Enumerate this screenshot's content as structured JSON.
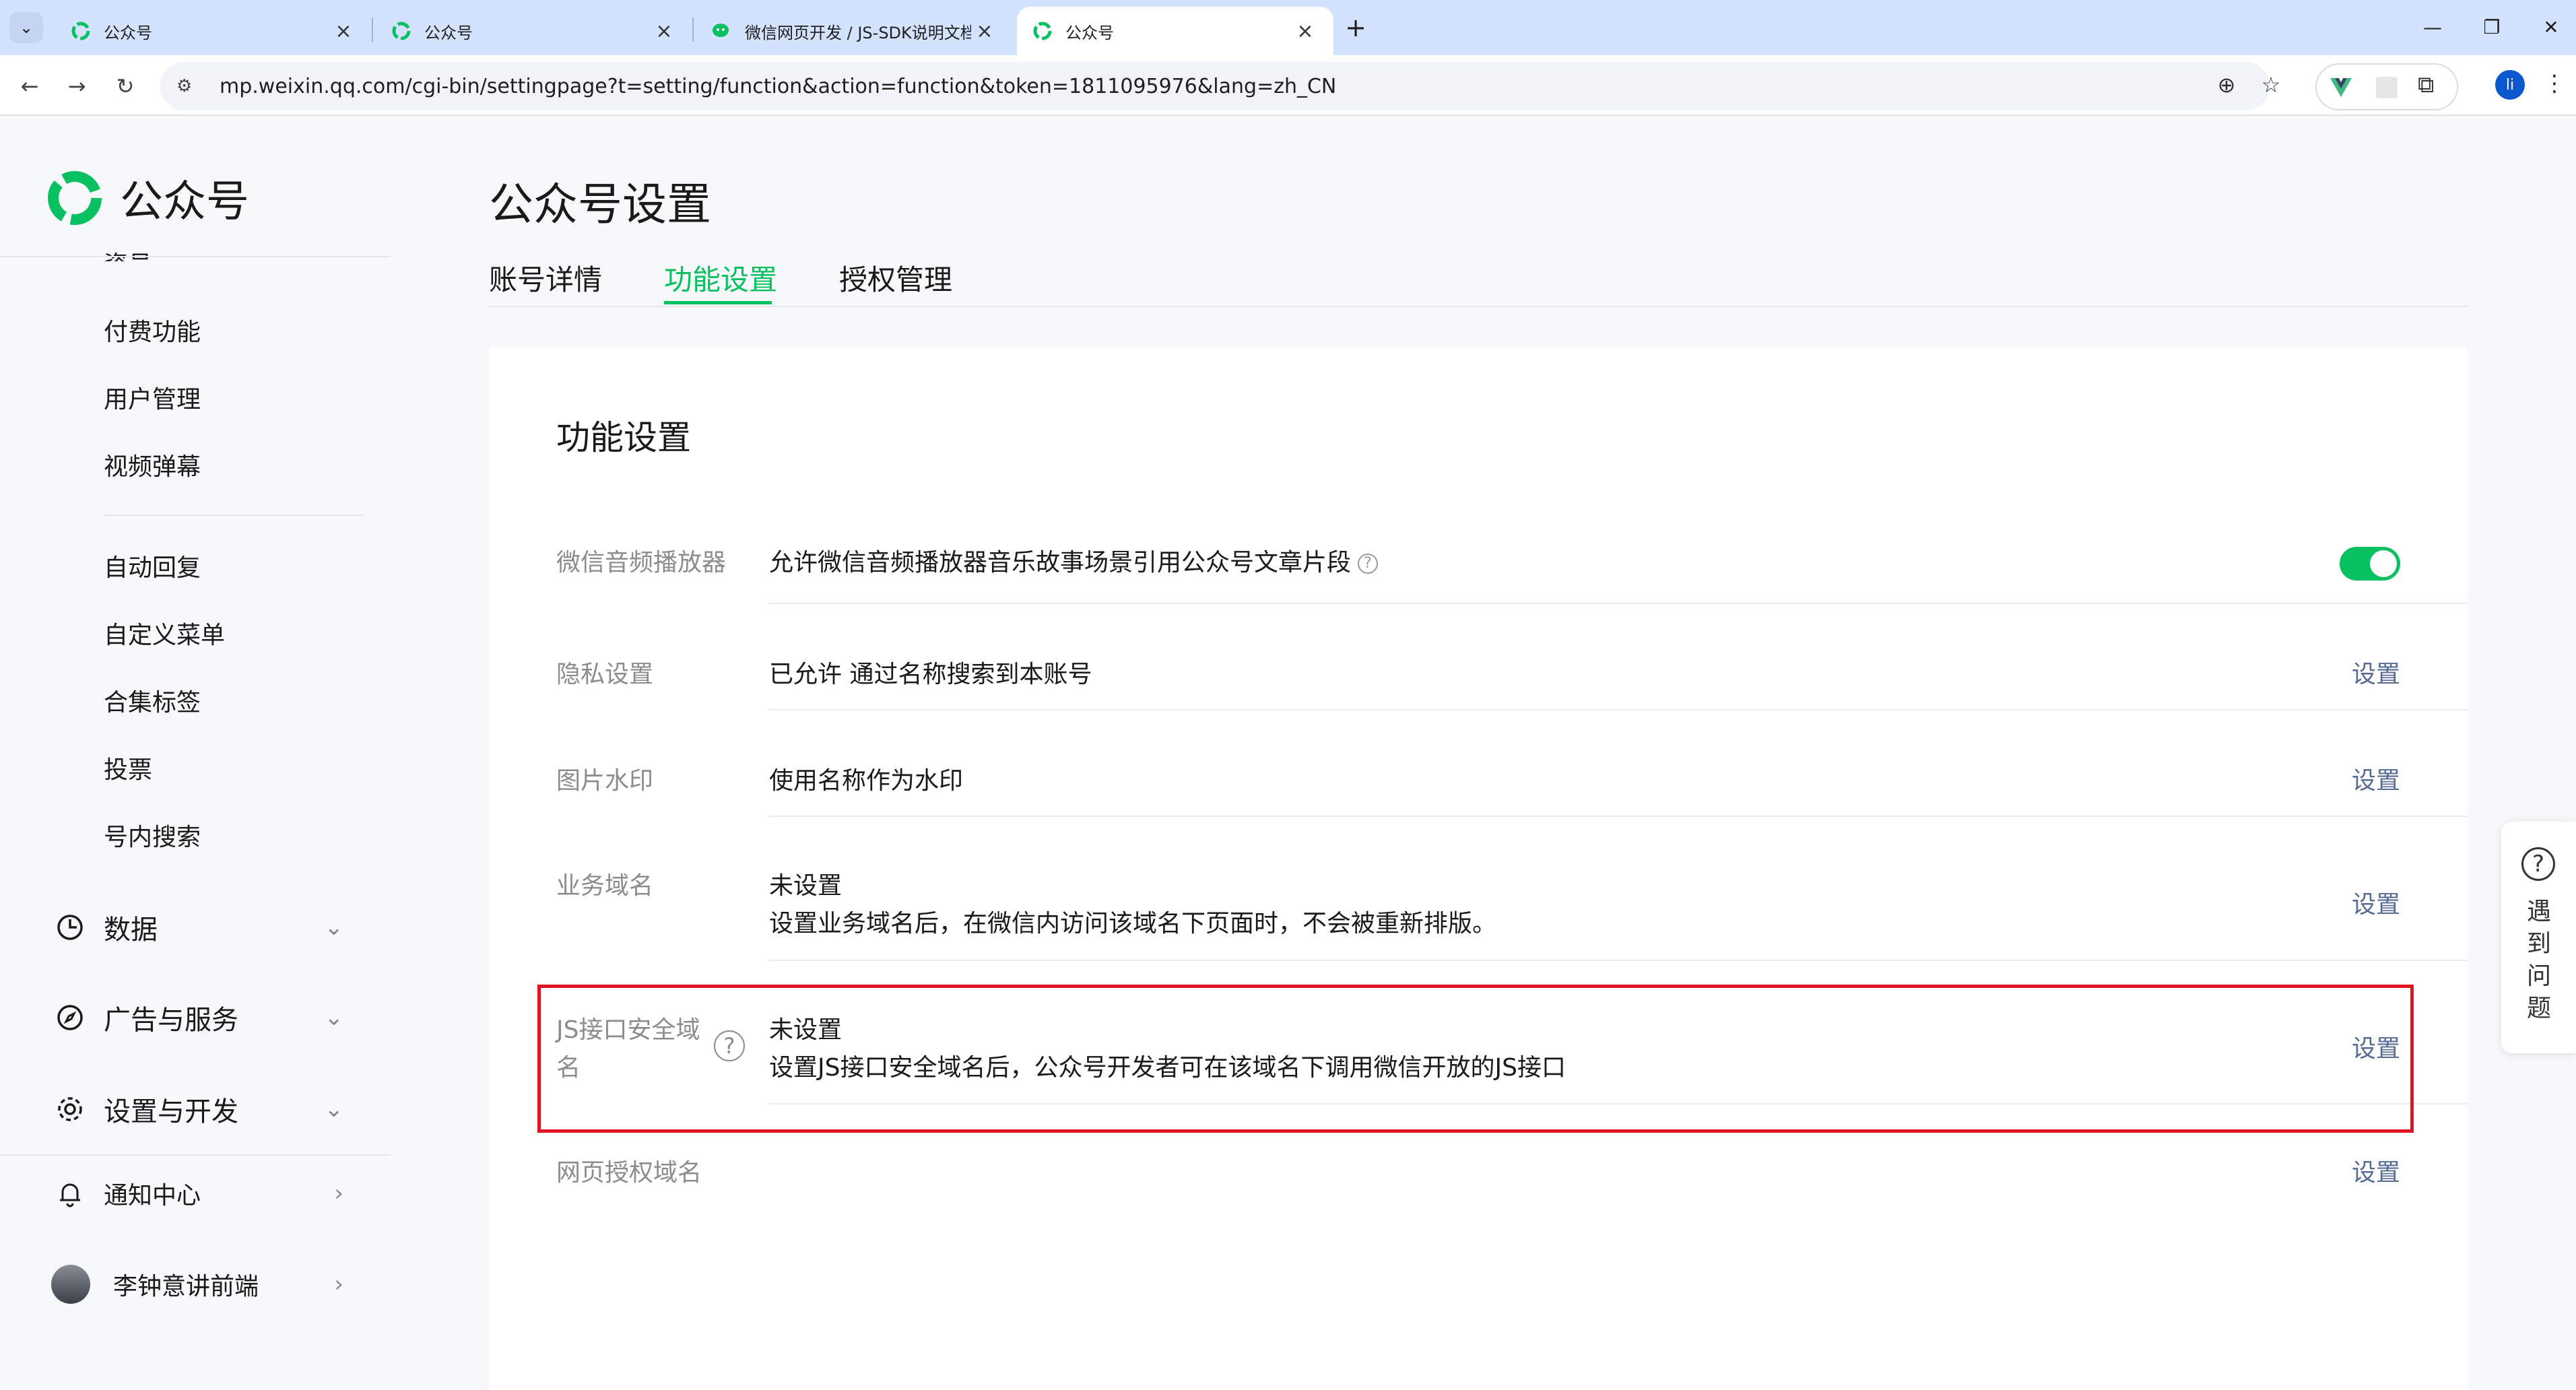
{
  "browser": {
    "tabs": [
      {
        "title": "公众号",
        "active": false
      },
      {
        "title": "公众号",
        "active": false
      },
      {
        "title": "微信网页开发 / JS-SDK说明文档",
        "active": false
      },
      {
        "title": "公众号",
        "active": true
      }
    ],
    "url": "mp.weixin.qq.com/cgi-bin/settingpage?t=setting/function&action=function&token=1811095976&lang=zh_CN",
    "profile_initial": "li"
  },
  "sidebar": {
    "logo_text": "公众号",
    "cut_item": "资员",
    "sub_items_group1": [
      "付费功能",
      "用户管理",
      "视频弹幕"
    ],
    "sub_items_group2": [
      "自动回复",
      "自定义菜单",
      "合集标签",
      "投票",
      "号内搜索"
    ],
    "categories": [
      {
        "label": "数据",
        "icon": "clock-icon"
      },
      {
        "label": "广告与服务",
        "icon": "compass-icon"
      },
      {
        "label": "设置与开发",
        "icon": "gear-icon"
      }
    ],
    "notification": "通知中心",
    "user_name": "李钟意讲前端"
  },
  "main": {
    "page_title": "公众号设置",
    "tabs": [
      "账号详情",
      "功能设置",
      "授权管理"
    ],
    "active_tab": "功能设置",
    "card_title": "功能设置",
    "rows": [
      {
        "label": "微信音频播放器",
        "content": "允许微信音频播放器音乐故事场景引用公众号文章片段",
        "toggle_on": true
      },
      {
        "label": "隐私设置",
        "content": "已允许 通过名称搜索到本账号",
        "action": "设置"
      },
      {
        "label": "图片水印",
        "content": "使用名称作为水印",
        "action": "设置"
      },
      {
        "label": "业务域名",
        "content": "未设置",
        "sub": "设置业务域名后，在微信内访问该域名下页面时，不会被重新排版。",
        "action": "设置"
      },
      {
        "label_line1": "JS接口安全域",
        "label_line2": "名",
        "content": "未设置",
        "sub": "设置JS接口安全域名后，公众号开发者可在该域名下调用微信开放的JS接口",
        "action": "设置"
      },
      {
        "label": "网页授权域名",
        "action": "设置"
      }
    ]
  },
  "help": {
    "text": "遇到问题"
  },
  "colors": {
    "accent": "#07c160",
    "link": "#576b95",
    "highlight": "#e0141f"
  }
}
